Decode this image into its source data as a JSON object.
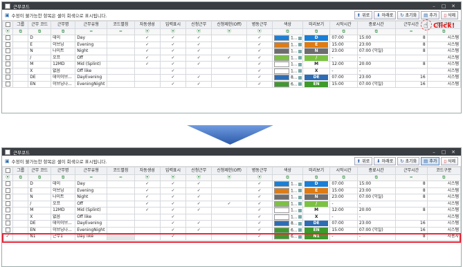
{
  "colors": {
    "accent": "#3a7bd5",
    "arrow": "#3566b8",
    "highlight": "#e02020"
  },
  "title": "근무코드",
  "info": "수정이 불가능한 항목은 셀이 회색으로 표시됩니다.",
  "toolbar": {
    "up": "위로",
    "down": "아래로",
    "reset": "초기화",
    "add": "추가",
    "delete": "삭제"
  },
  "click_label": "Click!",
  "columns": [
    "그룹",
    "근무 코드",
    "근무명",
    "근무유형",
    "코드별칭",
    "자동생성",
    "입력표시",
    "신청근무",
    "신청제한(Off)",
    "병동근무",
    "색상",
    "미리보기",
    "시작시간",
    "종료시간",
    "근무시간",
    "코드구분"
  ],
  "filter": {
    "sel": "⦿",
    "group": "⧉",
    "code": "⧉",
    "name": "⧉",
    "type": "=",
    "alias": "=",
    "check": "⦿",
    "color": "⧉",
    "preview": "⧉",
    "start": "⧉",
    "end": "⧉",
    "hours": "=",
    "kind": "⧉"
  },
  "rows": [
    {
      "code": "D",
      "name": "데이",
      "type": "Day",
      "auto": true,
      "input": true,
      "req": true,
      "restrict": false,
      "ward": true,
      "color_hex": "#1b7fd6",
      "color_txt": "1...",
      "preview_bg": "#1b7fd6",
      "preview": "D",
      "start": "07:00",
      "end": "15:00",
      "hours": "8",
      "kind": "시스템"
    },
    {
      "code": "E",
      "name": "이브닝",
      "type": "Evening",
      "auto": true,
      "input": true,
      "req": true,
      "restrict": false,
      "ward": true,
      "color_hex": "#e07b12",
      "color_txt": "1...",
      "preview_bg": "#e07b12",
      "preview": "E",
      "start": "15:00",
      "end": "23:00",
      "hours": "8",
      "kind": "시스템"
    },
    {
      "code": "N",
      "name": "나이트",
      "type": "Night",
      "auto": true,
      "input": true,
      "req": true,
      "restrict": false,
      "ward": true,
      "color_hex": "#6d6d6d",
      "color_txt": "1...",
      "preview_bg": "#6d6d6d",
      "preview": "N",
      "start": "23:00",
      "end": "07:00 (익일)",
      "hours": "8",
      "kind": "시스템"
    },
    {
      "code": "/",
      "name": "오프",
      "type": "Off",
      "auto": true,
      "input": true,
      "req": true,
      "restrict": true,
      "ward": true,
      "color_hex": "#7cc242",
      "color_txt": "1...",
      "preview_bg": "#7cc242",
      "preview": "/",
      "start": "-",
      "end": "-",
      "hours": "",
      "kind": "시스템"
    },
    {
      "code": "M",
      "name": "12MD",
      "type": "Mid (Splint)",
      "auto": true,
      "input": true,
      "req": true,
      "restrict": false,
      "ward": true,
      "color_hex": "#ffffff",
      "color_txt": "1...",
      "preview_bg": "#ffffff",
      "preview": "M",
      "start": "12:00",
      "end": "20:00",
      "hours": "8",
      "kind": "시스템"
    },
    {
      "code": "X",
      "name": "없음",
      "type": "Off like",
      "auto": false,
      "input": true,
      "req": false,
      "restrict": false,
      "ward": true,
      "color_hex": "#ffffff",
      "color_txt": "1...",
      "preview_bg": "#ffffff",
      "preview": "X",
      "start": "-",
      "end": "-",
      "hours": "",
      "kind": "시스템"
    },
    {
      "code": "DE",
      "name": "데이이브...",
      "type": "DayEvening",
      "auto": false,
      "input": true,
      "req": true,
      "restrict": false,
      "ward": true,
      "color_hex": "#2e6db3",
      "color_txt": "8...",
      "preview_bg": "#2e6db3",
      "preview": "DE",
      "start": "07:00",
      "end": "23:00",
      "hours": "16",
      "kind": "시스템"
    },
    {
      "code": "EN",
      "name": "이브닝나...",
      "type": "EveningNight",
      "auto": false,
      "input": true,
      "req": true,
      "restrict": false,
      "ward": true,
      "color_hex": "#3f9a2c",
      "color_txt": "6...",
      "preview_bg": "#3f9a2c",
      "preview": "EN",
      "start": "15:00",
      "end": "07:00 (익일)",
      "hours": "16",
      "kind": "시스템"
    }
  ],
  "new_row": {
    "code": "N1",
    "name": "근무1",
    "type": "Day like",
    "auto": false,
    "input": true,
    "req": false,
    "restrict": false,
    "ward": true,
    "color_hex": "#3f9a2c",
    "color_txt": "6...",
    "preview_bg": "#3f9a2c",
    "preview": "N1",
    "start": "-",
    "end": "-",
    "hours": "8",
    "kind": "사용자"
  }
}
